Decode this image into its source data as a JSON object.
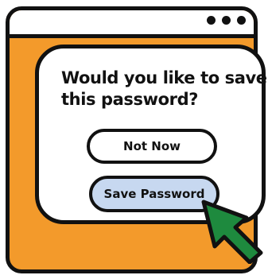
{
  "window": {
    "titlebar": {
      "controls": [
        "dot",
        "dot",
        "dot"
      ]
    }
  },
  "dialog": {
    "question": "Would you like to save this password?",
    "not_now_label": "Not Now",
    "save_label": "Save Password"
  },
  "colors": {
    "window_bg": "#F39A2B",
    "outline": "#111111",
    "save_button_bg": "#C7D8F0",
    "cursor": "#1E8A3E"
  },
  "icons": {
    "cursor": "arrow-cursor-icon",
    "window_controls": "dots-icon"
  }
}
